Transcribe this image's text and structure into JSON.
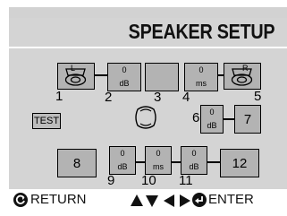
{
  "title": "SPEAKER SETUP",
  "speakers": {
    "front_left_label": "L",
    "front_right_label": "R",
    "front_left_number": "1",
    "front_right_number": "5"
  },
  "delays": {
    "front_left": {
      "value": "0",
      "unit": "dB",
      "number": "2"
    },
    "center": {
      "number": "3"
    },
    "front_right": {
      "value": "0",
      "unit": "ms",
      "number": "4"
    },
    "mid_right": {
      "value": "0",
      "unit": "dB",
      "number": "6"
    },
    "mid_right_box": "7",
    "rear_left_box": "8",
    "rear_1": {
      "value": "0",
      "unit": "dB",
      "number": "9"
    },
    "rear_2": {
      "value": "0",
      "unit": "ms",
      "number": "10"
    },
    "rear_3": {
      "value": "0",
      "unit": "dB",
      "number": "11"
    },
    "rear_right_box": "12"
  },
  "test_button": "TEST",
  "footer": {
    "return_label": "RETURN",
    "enter_label": "ENTER"
  }
}
